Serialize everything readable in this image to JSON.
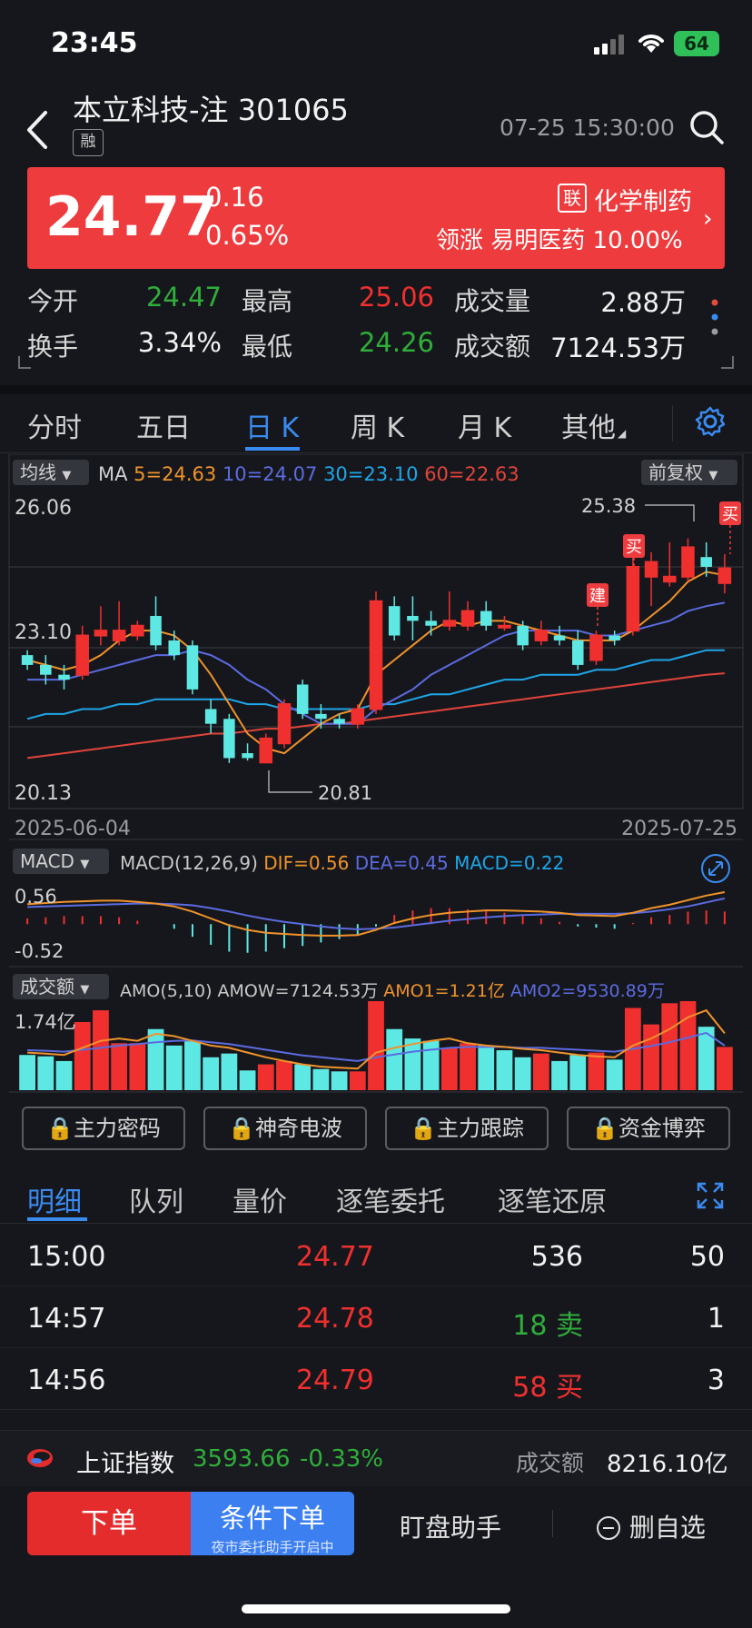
{
  "status_bar": {
    "time": "23:45",
    "battery": "64"
  },
  "header": {
    "name": "本立科技-注",
    "code": "301065",
    "margin_tag": "融",
    "datetime": "07-25 15:30:00"
  },
  "quote": {
    "price": "24.77",
    "change": "0.16",
    "change_pct": "0.65%",
    "lian_tag": "联",
    "sector": "化学制药",
    "leader_text": "领涨 易明医药 10.00%"
  },
  "stats": [
    {
      "label": "今开",
      "value": "24.47",
      "color": "green"
    },
    {
      "label": "最高",
      "value": "25.06",
      "color": "red"
    },
    {
      "label": "成交量",
      "value": "2.88万",
      "color": "white"
    },
    {
      "label": "换手",
      "value": "3.34%",
      "color": "white"
    },
    {
      "label": "最低",
      "value": "24.26",
      "color": "green"
    },
    {
      "label": "成交额",
      "value": "7124.53万",
      "color": "white"
    }
  ],
  "tabs": [
    "分时",
    "五日",
    "日 K",
    "周 K",
    "月 K",
    "其他"
  ],
  "chart_labels": {
    "ma_pill": "均线",
    "ma_prefix": "MA",
    "ma5": "5=24.63",
    "ma10": "10=24.07",
    "ma30": "30=23.10",
    "ma60": "60=22.63",
    "adjust_pill": "前复权",
    "y_top": "26.06",
    "y_mid": "23.10",
    "y_bottom": "20.13",
    "high_mark": "25.38",
    "low_mark": "20.81",
    "date_start": "2025-06-04",
    "date_end": "2025-07-25",
    "signal_build": "建",
    "signal_buy": "买",
    "macd_pill": "MACD",
    "macd_params": "MACD(12,26,9)",
    "dif": "DIF=0.56",
    "dea": "DEA=0.45",
    "macd_val": "MACD=0.22",
    "macd_top": "0.56",
    "macd_bottom": "-0.52",
    "amo_pill": "成交额",
    "amo_params": "AMO(5,10)",
    "amow": "AMOW=7124.53万",
    "amo1": "AMO1=1.21亿",
    "amo2": "AMO2=9530.89万",
    "amo_top": "1.74亿"
  },
  "chart_data": {
    "type": "candlestick",
    "x_range": [
      "2025-06-04",
      "2025-07-25"
    ],
    "ylim": [
      20.13,
      26.06
    ],
    "candles": [
      {
        "o": 23.0,
        "c": 22.8,
        "h": 23.1,
        "l": 22.7
      },
      {
        "o": 22.8,
        "c": 22.6,
        "h": 23.0,
        "l": 22.4
      },
      {
        "o": 22.6,
        "c": 22.5,
        "h": 22.8,
        "l": 22.3
      },
      {
        "o": 22.6,
        "c": 23.4,
        "h": 23.6,
        "l": 22.5
      },
      {
        "o": 23.4,
        "c": 23.5,
        "h": 24.0,
        "l": 23.2
      },
      {
        "o": 23.3,
        "c": 23.5,
        "h": 24.1,
        "l": 23.2
      },
      {
        "o": 23.4,
        "c": 23.6,
        "h": 23.7,
        "l": 23.3
      },
      {
        "o": 23.8,
        "c": 23.2,
        "h": 24.2,
        "l": 23.1
      },
      {
        "o": 23.3,
        "c": 23.0,
        "h": 23.5,
        "l": 22.9
      },
      {
        "o": 23.2,
        "c": 22.3,
        "h": 23.3,
        "l": 22.2
      },
      {
        "o": 21.9,
        "c": 21.6,
        "h": 22.1,
        "l": 21.4
      },
      {
        "o": 21.7,
        "c": 20.9,
        "h": 21.8,
        "l": 20.8
      },
      {
        "o": 21.0,
        "c": 20.9,
        "h": 21.2,
        "l": 20.85
      },
      {
        "o": 20.81,
        "c": 21.3,
        "h": 21.4,
        "l": 20.81
      },
      {
        "o": 21.2,
        "c": 22.0,
        "h": 22.1,
        "l": 21.1
      },
      {
        "o": 22.4,
        "c": 21.8,
        "h": 22.5,
        "l": 21.7
      },
      {
        "o": 21.8,
        "c": 21.7,
        "h": 22.0,
        "l": 21.5
      },
      {
        "o": 21.7,
        "c": 21.6,
        "h": 21.8,
        "l": 21.5
      },
      {
        "o": 21.6,
        "c": 21.9,
        "h": 22.0,
        "l": 21.5
      },
      {
        "o": 21.9,
        "c": 24.1,
        "h": 24.3,
        "l": 21.8
      },
      {
        "o": 24.0,
        "c": 23.4,
        "h": 24.2,
        "l": 23.3
      },
      {
        "o": 23.8,
        "c": 23.7,
        "h": 24.2,
        "l": 23.3
      },
      {
        "o": 23.7,
        "c": 23.6,
        "h": 23.9,
        "l": 23.4
      },
      {
        "o": 23.6,
        "c": 23.7,
        "h": 24.3,
        "l": 23.5
      },
      {
        "o": 23.6,
        "c": 23.9,
        "h": 24.1,
        "l": 23.5
      },
      {
        "o": 23.9,
        "c": 23.6,
        "h": 24.1,
        "l": 23.5
      },
      {
        "o": 23.6,
        "c": 23.6,
        "h": 23.8,
        "l": 23.5
      },
      {
        "o": 23.6,
        "c": 23.2,
        "h": 23.7,
        "l": 23.1
      },
      {
        "o": 23.3,
        "c": 23.5,
        "h": 23.7,
        "l": 23.2
      },
      {
        "o": 23.4,
        "c": 23.3,
        "h": 23.6,
        "l": 23.2
      },
      {
        "o": 23.3,
        "c": 22.8,
        "h": 23.5,
        "l": 22.7
      },
      {
        "o": 22.9,
        "c": 23.4,
        "h": 23.5,
        "l": 22.8
      },
      {
        "o": 23.4,
        "c": 23.3,
        "h": 23.5,
        "l": 23.2
      },
      {
        "o": 23.5,
        "c": 24.8,
        "h": 25.0,
        "l": 23.4
      },
      {
        "o": 24.6,
        "c": 24.9,
        "h": 25.1,
        "l": 24.0
      },
      {
        "o": 24.5,
        "c": 24.6,
        "h": 25.3,
        "l": 24.4
      },
      {
        "o": 24.6,
        "c": 25.2,
        "h": 25.38,
        "l": 24.5
      },
      {
        "o": 25.0,
        "c": 24.8,
        "h": 25.3,
        "l": 24.6
      },
      {
        "o": 24.47,
        "c": 24.77,
        "h": 25.06,
        "l": 24.26
      }
    ],
    "ma5": [
      22.9,
      22.8,
      22.7,
      22.8,
      23.0,
      23.3,
      23.5,
      23.5,
      23.4,
      23.1,
      22.6,
      22.0,
      21.4,
      21.1,
      21.0,
      21.3,
      21.6,
      21.8,
      21.9,
      22.6,
      22.9,
      23.2,
      23.5,
      23.7,
      23.6,
      23.7,
      23.7,
      23.6,
      23.5,
      23.4,
      23.3,
      23.3,
      23.3,
      23.5,
      23.8,
      24.1,
      24.5,
      24.7,
      24.63
    ],
    "ma10": [
      22.5,
      22.5,
      22.5,
      22.6,
      22.7,
      22.8,
      22.9,
      23.0,
      23.0,
      23.1,
      23.0,
      22.8,
      22.5,
      22.3,
      22.0,
      21.8,
      21.6,
      21.6,
      21.6,
      21.9,
      22.1,
      22.3,
      22.6,
      22.8,
      23.0,
      23.2,
      23.4,
      23.5,
      23.5,
      23.5,
      23.5,
      23.4,
      23.4,
      23.5,
      23.6,
      23.7,
      23.9,
      24.0,
      24.07
    ],
    "ma30": [
      21.7,
      21.8,
      21.8,
      21.9,
      21.9,
      22.0,
      22.0,
      22.1,
      22.1,
      22.1,
      22.1,
      22.1,
      22.0,
      22.0,
      21.9,
      21.9,
      21.9,
      21.9,
      21.9,
      22.0,
      22.0,
      22.1,
      22.2,
      22.2,
      22.3,
      22.4,
      22.5,
      22.5,
      22.6,
      22.6,
      22.6,
      22.7,
      22.7,
      22.8,
      22.9,
      22.9,
      23.0,
      23.1,
      23.1
    ],
    "ma60": [
      20.9,
      20.95,
      21.0,
      21.05,
      21.1,
      21.15,
      21.2,
      21.25,
      21.3,
      21.35,
      21.4,
      21.4,
      21.45,
      21.5,
      21.5,
      21.55,
      21.6,
      21.6,
      21.65,
      21.7,
      21.75,
      21.8,
      21.85,
      21.9,
      21.95,
      22.0,
      22.05,
      22.1,
      22.15,
      22.2,
      22.25,
      22.3,
      22.35,
      22.4,
      22.45,
      22.5,
      22.55,
      22.6,
      22.63
    ],
    "macd": {
      "ylim": [
        -0.52,
        0.56
      ],
      "dif": [
        0.35,
        0.37,
        0.39,
        0.4,
        0.41,
        0.41,
        0.39,
        0.36,
        0.31,
        0.22,
        0.1,
        -0.02,
        -0.1,
        -0.15,
        -0.17,
        -0.19,
        -0.2,
        -0.2,
        -0.19,
        -0.1,
        0.02,
        0.1,
        0.16,
        0.2,
        0.22,
        0.24,
        0.24,
        0.23,
        0.22,
        0.2,
        0.16,
        0.15,
        0.14,
        0.2,
        0.28,
        0.34,
        0.42,
        0.5,
        0.56
      ],
      "dea": [
        0.3,
        0.31,
        0.32,
        0.33,
        0.34,
        0.35,
        0.36,
        0.36,
        0.35,
        0.33,
        0.28,
        0.22,
        0.15,
        0.09,
        0.04,
        0.0,
        -0.04,
        -0.07,
        -0.09,
        -0.08,
        -0.06,
        -0.02,
        0.02,
        0.06,
        0.09,
        0.12,
        0.14,
        0.16,
        0.17,
        0.18,
        0.18,
        0.18,
        0.18,
        0.19,
        0.22,
        0.26,
        0.31,
        0.38,
        0.45
      ],
      "hist": [
        0.1,
        0.12,
        0.14,
        0.14,
        0.14,
        0.12,
        0.06,
        0.0,
        -0.08,
        -0.22,
        -0.36,
        -0.48,
        -0.5,
        -0.48,
        -0.42,
        -0.38,
        -0.32,
        -0.26,
        -0.2,
        -0.04,
        0.16,
        0.24,
        0.28,
        0.28,
        0.26,
        0.24,
        0.2,
        0.14,
        0.1,
        0.04,
        -0.04,
        -0.06,
        -0.08,
        0.02,
        0.12,
        0.16,
        0.22,
        0.24,
        0.22
      ]
    },
    "amo": {
      "ylim": [
        0,
        1.74
      ],
      "values": [
        0.75,
        0.72,
        0.62,
        1.45,
        1.7,
        1.0,
        1.0,
        1.3,
        0.95,
        1.05,
        0.7,
        0.78,
        0.42,
        0.55,
        0.62,
        0.55,
        0.45,
        0.4,
        0.4,
        2.2,
        1.3,
        1.1,
        1.05,
        0.9,
        1.0,
        0.95,
        0.85,
        0.7,
        0.78,
        0.62,
        0.75,
        0.8,
        0.65,
        1.75,
        1.4,
        1.85,
        2.02,
        1.35,
        0.92
      ],
      "up": [
        false,
        false,
        false,
        true,
        true,
        true,
        true,
        false,
        false,
        false,
        false,
        false,
        false,
        true,
        true,
        false,
        false,
        false,
        true,
        true,
        false,
        false,
        false,
        true,
        true,
        false,
        false,
        false,
        true,
        false,
        false,
        true,
        false,
        true,
        true,
        true,
        true,
        false,
        true
      ],
      "amo1": [
        0.8,
        0.78,
        0.75,
        0.9,
        1.05,
        1.1,
        1.05,
        1.2,
        1.15,
        1.05,
        0.95,
        0.9,
        0.8,
        0.7,
        0.62,
        0.55,
        0.5,
        0.48,
        0.46,
        0.8,
        0.9,
        0.98,
        1.05,
        1.1,
        1.0,
        0.95,
        0.92,
        0.88,
        0.85,
        0.8,
        0.75,
        0.72,
        0.7,
        0.95,
        1.1,
        1.3,
        1.55,
        1.7,
        1.21
      ],
      "amo2": [
        0.85,
        0.84,
        0.82,
        0.86,
        0.9,
        0.95,
        0.98,
        1.02,
        1.05,
        1.06,
        1.02,
        0.98,
        0.92,
        0.86,
        0.8,
        0.74,
        0.7,
        0.66,
        0.62,
        0.7,
        0.76,
        0.82,
        0.86,
        0.9,
        0.92,
        0.92,
        0.92,
        0.9,
        0.9,
        0.88,
        0.86,
        0.84,
        0.82,
        0.88,
        0.94,
        1.02,
        1.12,
        1.22,
        0.95
      ]
    }
  },
  "feature_buttons": [
    "主力密码",
    "神奇电波",
    "主力跟踪",
    "资金博弈"
  ],
  "detail_tabs": [
    "明细",
    "队列",
    "量价",
    "逐笔委托",
    "逐笔还原"
  ],
  "trades": [
    {
      "time": "15:00",
      "price": "24.77",
      "vol": "536",
      "side": "",
      "count": "50",
      "vol_color": "white"
    },
    {
      "time": "14:57",
      "price": "24.78",
      "vol": "18",
      "side": "卖",
      "count": "1",
      "vol_color": "green"
    },
    {
      "time": "14:56",
      "price": "24.79",
      "vol": "58",
      "side": "买",
      "count": "3",
      "vol_color": "red"
    }
  ],
  "index_bar": {
    "name": "上证指数",
    "value": "3593.66",
    "change": "-0.33%",
    "turnover_label": "成交额",
    "turnover": "8216.10亿"
  },
  "bottom": {
    "order": "下单",
    "cond_order": "条件下单",
    "cond_sub": "夜市委托助手开启中",
    "watch_helper": "盯盘助手",
    "remove_fav": "删自选"
  },
  "colors": {
    "up": "#f0302f",
    "down": "#5ee8e3",
    "ma5": "#f0932b",
    "ma10": "#5b6be0",
    "ma30": "#1ea6e8",
    "ma60": "#e0443a",
    "accent": "#3a8bf0"
  }
}
